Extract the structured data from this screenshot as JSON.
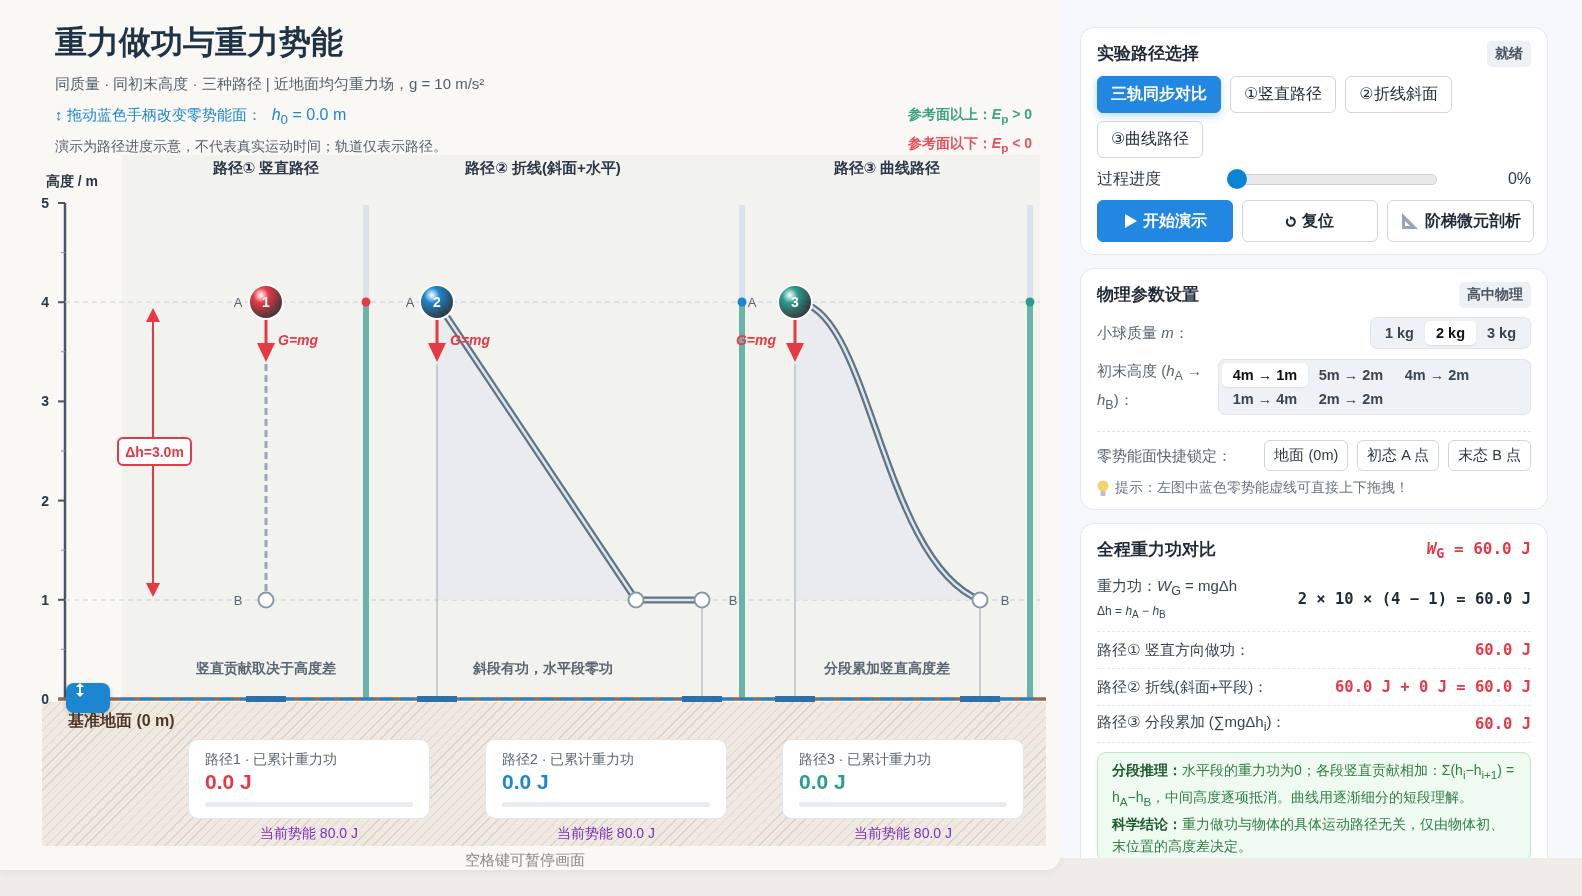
{
  "header": {
    "title": "重力做功与重力势能",
    "subtitle": "同质量 · 同初末高度 · 三种路径 | 近地面均匀重力场，g = 10 m/s²",
    "drag_hint": "↕ 拖动蓝色手柄改变零势能面：",
    "zero_level": "*h*$_{0}$ = 0.0 m",
    "note": "演示为路径进度示意，不代表真实运动时间；轨道仅表示路径。",
    "legend": [
      {
        "text": "参考面以上：*E*$_{p}$ > 0",
        "color": "#3aa37f"
      },
      {
        "text": "参考面以下：*E*$_{p}$ < 0",
        "color": "#e8505b"
      }
    ]
  },
  "diagram": {
    "y_axis_label": "高度 / m",
    "y_ticks": [
      "5",
      "4",
      "3",
      "2",
      "1",
      "0"
    ],
    "height_difference": "Δh=3.0m",
    "tracks": [
      {
        "kind": "vertical",
        "title": "路径① 竖直路径",
        "caption": "竖直贡献取决于高度差",
        "ball": "1",
        "start_label": "A",
        "end_label": "B",
        "force": "G=mg",
        "color": "#e63946"
      },
      {
        "kind": "polyline",
        "title": "路径② 折线(斜面+水平)",
        "caption": "斜段有功，水平段零功",
        "ball": "2",
        "start_label": "A",
        "end_label": "B",
        "force": "G=mg",
        "color": "#1c86d1"
      },
      {
        "kind": "curve",
        "title": "路径③ 曲线路径",
        "caption": "分段累加竖直高度差",
        "ball": "3",
        "start_label": "A",
        "end_label": "B",
        "force": "G=mg",
        "color": "#2a9d8f"
      }
    ]
  },
  "ground": {
    "label": "基准地面 (0 m)",
    "cards": [
      {
        "title": "路径1 · 已累计重力功",
        "work": "0.0 J",
        "level": 0,
        "potential": "当前势能 80.0 J",
        "color": "#e63946"
      },
      {
        "title": "路径2 · 已累计重力功",
        "work": "0.0 J",
        "level": 0,
        "potential": "当前势能 80.0 J",
        "color": "#1c86d1"
      },
      {
        "title": "路径3 · 已累计重力功",
        "work": "0.0 J",
        "level": 0,
        "potential": "当前势能 80.0 J",
        "color": "#2a9d8f"
      }
    ],
    "footer": "空格键可暂停画面"
  },
  "path_panel": {
    "title": "实验路径选择",
    "status": "就绪",
    "modes": [
      {
        "label": "三轨同步对比",
        "selected": true
      },
      {
        "label": "①竖直路径",
        "selected": false
      },
      {
        "label": "②折线斜面",
        "selected": false
      },
      {
        "label": "③曲线路径",
        "selected": false
      }
    ],
    "progress": {
      "label": "过程进度",
      "level": 0,
      "reading": "0%"
    },
    "actions": [
      {
        "kind": "play",
        "label": "开始演示"
      },
      {
        "kind": "reset",
        "label": "复位"
      },
      {
        "kind": "analyze",
        "label": "阶梯微元剖析"
      }
    ]
  },
  "params": {
    "title": "物理参数设置",
    "badge": "高中物理",
    "mass": {
      "label": "小球质量 *m*：",
      "options": [
        {
          "label": "1 kg",
          "selected": false
        },
        {
          "label": "2 kg",
          "selected": true
        },
        {
          "label": "3 kg",
          "selected": false
        }
      ]
    },
    "heights": {
      "label": "初末高度 (*h*$_{A}$ → *h*$_{B}$)：",
      "options": [
        {
          "label": "4m → 1m",
          "selected": true
        },
        {
          "label": "5m → 2m",
          "selected": false
        },
        {
          "label": "4m → 2m",
          "selected": false
        },
        {
          "label": "1m → 4m",
          "selected": false
        },
        {
          "label": "2m → 2m",
          "selected": false
        }
      ]
    },
    "anchor": {
      "label": "零势能面快捷锁定：",
      "buttons": [
        "地面 (0m)",
        "初态 A 点",
        "末态 B 点"
      ]
    },
    "hint": "提示：左图中蓝色零势能虚线可直接上下拖拽！"
  },
  "work": {
    "title": "全程重力功对比",
    "total": "*W*$_{G}$ = 60.0 J",
    "formula": "重力功：*W*$_{G}$ = mgΔh",
    "formula_note": "Δh = *h*$_{A}$ − *h*$_{B}$",
    "calculation": "2 × 10 × (4 − 1) = 60.0 J",
    "rows": [
      {
        "label": "路径① 竖直方向做功：",
        "value": "60.0 J"
      },
      {
        "label": "路径② 折线(斜面+平段)：",
        "value": "60.0 J + 0 J = 60.0 J"
      },
      {
        "label": "路径③ 分段累加 (∑mgΔh$_{i}$)：",
        "value": "60.0 J"
      }
    ],
    "notes": [
      "**分段推理：**水平段的重力功为0；各段竖直贡献相加：Σ(h$_{i}$−h$_{i+1}$) = h$_{A}$−h$_{B}$，中间高度逐项抵消。曲线用逐渐细分的短段理解。",
      "**科学结论：**重力做功与物体的具体运动路径无关，仅由物体初、末位置的高度差决定。"
    ]
  }
}
